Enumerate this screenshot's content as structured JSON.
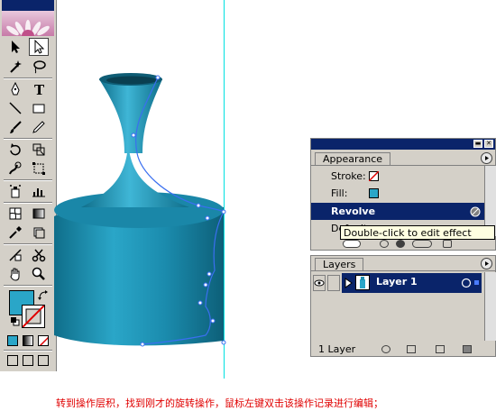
{
  "toolbox": {
    "tools": [
      {
        "name": "selection-tool",
        "glyph": "arrow-black"
      },
      {
        "name": "direct-selection-tool",
        "glyph": "arrow-white"
      },
      {
        "name": "magic-wand-tool",
        "glyph": "wand"
      },
      {
        "name": "lasso-tool",
        "glyph": "lasso"
      },
      {
        "name": "pen-tool",
        "glyph": "pen"
      },
      {
        "name": "type-tool",
        "glyph": "T"
      },
      {
        "name": "line-tool",
        "glyph": "line"
      },
      {
        "name": "rectangle-tool",
        "glyph": "rect"
      },
      {
        "name": "paintbrush-tool",
        "glyph": "brush"
      },
      {
        "name": "pencil-tool",
        "glyph": "pencil"
      },
      {
        "name": "rotate-tool",
        "glyph": "rotate"
      },
      {
        "name": "scale-tool",
        "glyph": "scale"
      },
      {
        "name": "warp-tool",
        "glyph": "warp"
      },
      {
        "name": "free-transform-tool",
        "glyph": "freetransform"
      },
      {
        "name": "symbol-sprayer-tool",
        "glyph": "spray"
      },
      {
        "name": "graph-tool",
        "glyph": "graph"
      },
      {
        "name": "mesh-tool",
        "glyph": "mesh"
      },
      {
        "name": "gradient-tool",
        "glyph": "gradient"
      },
      {
        "name": "eyedropper-tool",
        "glyph": "eyedropper"
      },
      {
        "name": "blend-tool",
        "glyph": "blend"
      },
      {
        "name": "slice-tool",
        "glyph": "slice"
      },
      {
        "name": "scissors-tool",
        "glyph": "scissors"
      },
      {
        "name": "hand-tool",
        "glyph": "hand"
      },
      {
        "name": "zoom-tool",
        "glyph": "zoom"
      }
    ],
    "fill_color": "#2aa6c8",
    "stroke_color": "none"
  },
  "appearance": {
    "tab_label": "Appearance",
    "rows": [
      {
        "label": "Stroke:",
        "swatch": "none"
      },
      {
        "label": "Fill:",
        "swatch": "#2aa6c8"
      },
      {
        "label": "Revolve",
        "selected": true
      },
      {
        "label": "Default T",
        "partial": true
      }
    ],
    "tooltip": "Double-click to edit effect"
  },
  "layers": {
    "tab_label": "Layers",
    "layer_name": "Layer 1",
    "footer_count": "1 Layer"
  },
  "caption": "转到操作层积，找到刚才的旋转操作，鼠标左键双击该操作记录进行编辑；",
  "colors": {
    "accent": "#0a246a",
    "panel": "#d4d0c8",
    "vase": "#1f8fb0",
    "path": "#3a6ff0",
    "caption": "#e00000"
  }
}
